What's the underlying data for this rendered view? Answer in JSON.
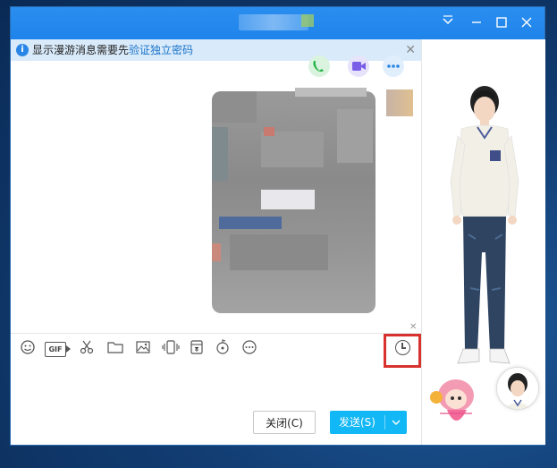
{
  "window": {
    "controls": {
      "minimize": "✕",
      "restore": "☐",
      "close": "✕"
    }
  },
  "notice": {
    "text_prefix": "显示漫游消息需要先",
    "link": "验证独立密码",
    "close": "✕"
  },
  "toolbar": {
    "items": [
      "emoji-icon",
      "gif-icon",
      "scissors-icon",
      "folder-icon",
      "image-icon",
      "shake-icon",
      "red-packet-icon",
      "music-icon",
      "more-icon"
    ],
    "gif_label": "GIF",
    "history": "history-icon"
  },
  "buttons": {
    "close_label": "关闭(C)",
    "send_label": "发送(S)",
    "send_dropdown": "∨"
  },
  "colors": {
    "titlebar": "#1f84ea",
    "send_button": "#12b7f5",
    "highlight": "#d8322f",
    "notice_bg": "#d9ebfb"
  }
}
